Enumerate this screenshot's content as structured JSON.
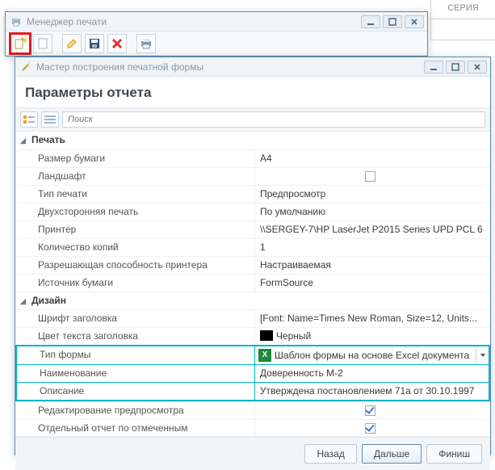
{
  "bg": {
    "col": "СЕРИЯ"
  },
  "printmgr": {
    "title": "Менеджер печати"
  },
  "wizard": {
    "title": "Мастер построения печатной формы",
    "heading": "Параметры отчета",
    "search_placeholder": "Поиск",
    "footer": {
      "back": "Назад",
      "next": "Дальше",
      "finish": "Финиш"
    },
    "groups": {
      "print": {
        "label": "Печать",
        "rows": {
          "paper_size": {
            "label": "Размер бумаги",
            "value": "A4"
          },
          "landscape": {
            "label": "Ландшафт",
            "checked": false
          },
          "print_type": {
            "label": "Тип печати",
            "value": "Предпросмотр"
          },
          "duplex": {
            "label": "Двухсторонняя печать",
            "value": "По умолчанию"
          },
          "printer": {
            "label": "Принтер",
            "value": "\\\\SERGEY-7\\HP LaserJet P2015 Series UPD PCL 6"
          },
          "copies": {
            "label": "Количество копий",
            "value": "1"
          },
          "resolution": {
            "label": "Разрешающая способность принтера",
            "value": "Настраиваемая"
          },
          "paper_source": {
            "label": "Источник бумаги",
            "value": "FormSource"
          }
        }
      },
      "design": {
        "label": "Дизайн",
        "rows": {
          "title_font": {
            "label": "Шрифт заголовка",
            "value": "[Font: Name=Times New Roman, Size=12, Units..."
          },
          "title_color": {
            "label": "Цвет текста заголовка",
            "value": "Черный",
            "swatch": "#000000"
          },
          "form_type": {
            "label": "Тип формы",
            "value": "Шаблон формы на основе Excel документа"
          },
          "name": {
            "label": "Наименование",
            "value": "Доверенность М-2"
          },
          "description": {
            "label": "Описание",
            "value": "Утверждена постановлением 71а от 30.10.1997"
          },
          "edit_preview": {
            "label": "Редактирование предпросмотра",
            "checked": true
          },
          "sep_report": {
            "label": "Отдельный отчет по отмеченным",
            "checked": true
          }
        }
      }
    }
  }
}
